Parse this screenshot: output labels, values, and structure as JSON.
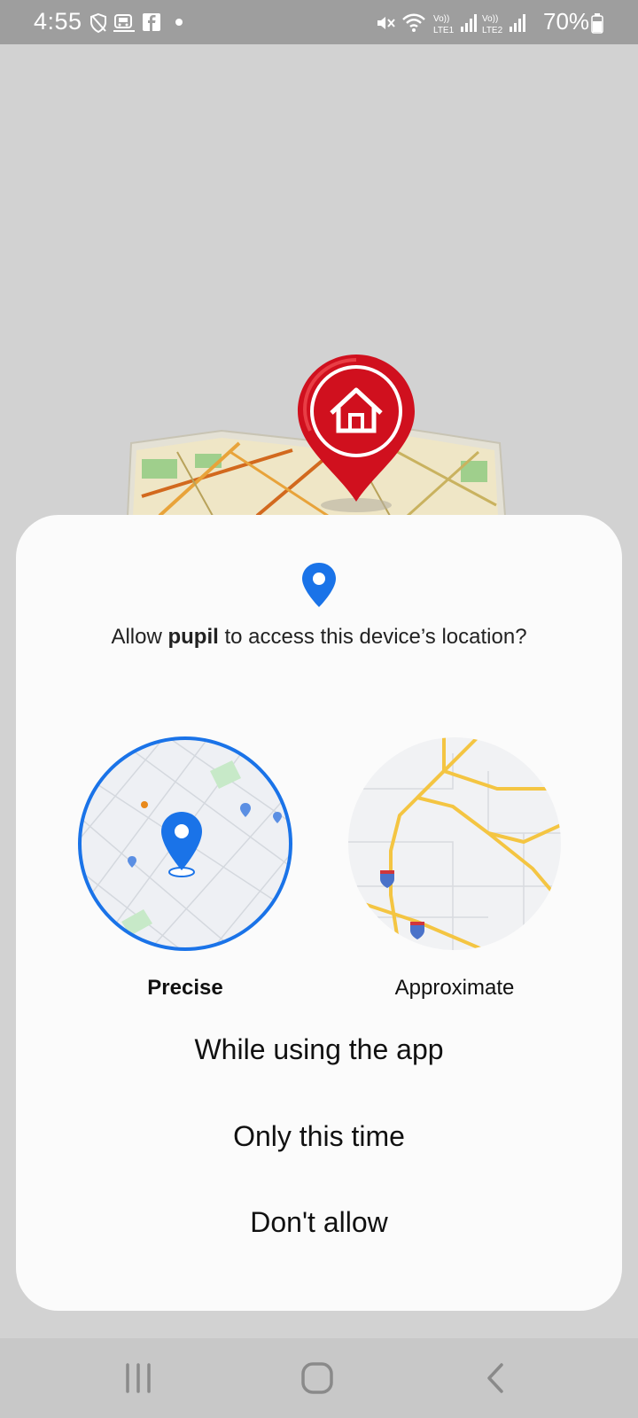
{
  "status_bar": {
    "time": "4:55",
    "left_icons": [
      "shield-icon",
      "train-icon",
      "facebook-icon",
      "dot-icon"
    ],
    "right_icons": [
      "mute-icon",
      "wifi-icon",
      "lte1-signal-icon",
      "lte2-signal-icon"
    ],
    "battery_percent": "70%"
  },
  "background": {
    "illustration": "map-with-home-pin",
    "pin_color": "#d0101e"
  },
  "dialog": {
    "icon": "location-pin-icon",
    "title_prefix": "Allow ",
    "app_name": "pupil",
    "title_suffix": " to access this device’s location?",
    "options": [
      {
        "label": "Precise",
        "selected": true
      },
      {
        "label": "Approximate",
        "selected": false
      }
    ],
    "actions": [
      "While using the app",
      "Only this time",
      "Don't allow"
    ]
  },
  "nav_bar": {
    "buttons": [
      "recents-icon",
      "home-icon",
      "back-icon"
    ]
  },
  "colors": {
    "accent": "#1a73e8",
    "dialog_bg": "#fbfbfb",
    "scrim": "#d2d2d2",
    "road_yellow": "#f4c542"
  }
}
